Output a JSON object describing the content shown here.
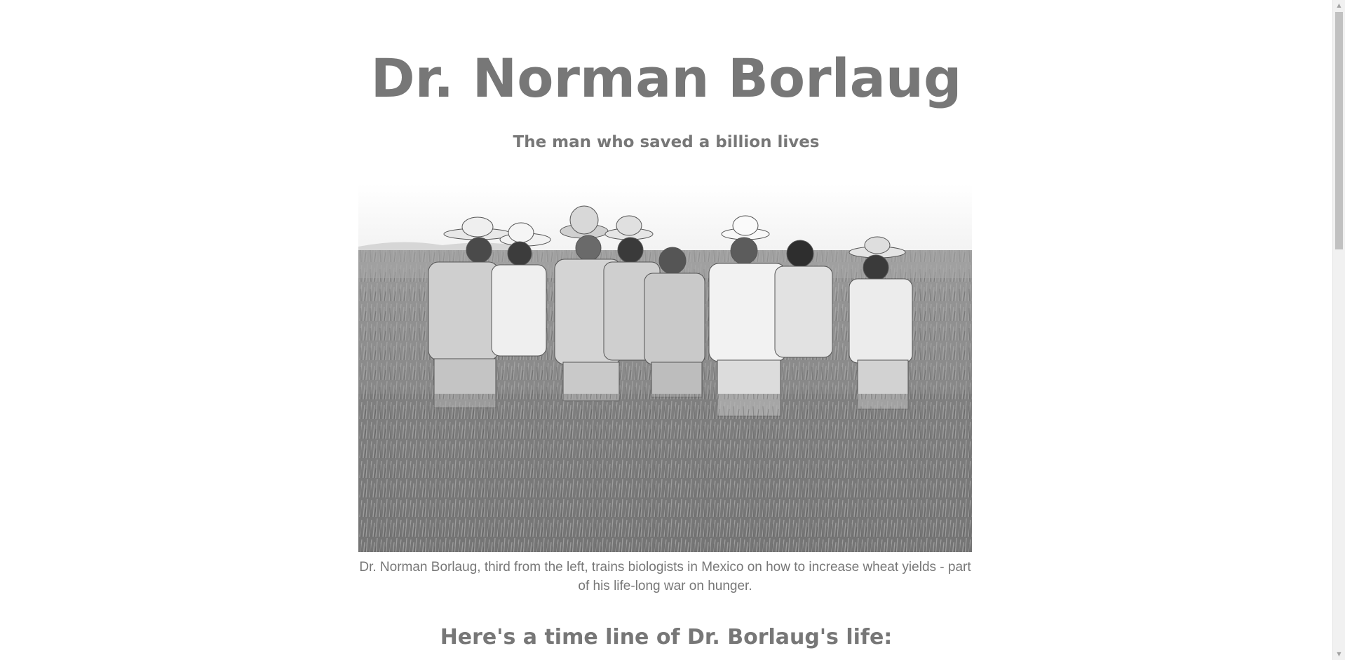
{
  "header": {
    "title": "Dr. Norman Borlaug",
    "subtitle": "The man who saved a billion lives"
  },
  "figure": {
    "image_description_icon": "photo-of-men-in-wheat-field",
    "caption": "Dr. Norman Borlaug, third from the left, trains biologists in Mexico on how to increase wheat yields - part of his life-long war on hunger."
  },
  "timeline": {
    "heading": "Here's a time line of Dr. Borlaug's life:"
  },
  "colors": {
    "text": "#777777",
    "background": "#ffffff",
    "scrollbar_track": "#f1f1f1",
    "scrollbar_thumb": "#c1c1c1"
  },
  "scrollbar": {
    "up_icon": "triangle-up-icon",
    "down_icon": "triangle-down-icon"
  }
}
